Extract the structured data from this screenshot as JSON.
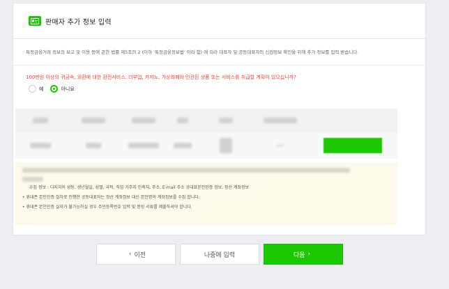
{
  "header": {
    "title": "판매자 추가 정보 입력"
  },
  "notice": {
    "text": "· 특정금융거래 정보의 보고 및 이용 등에 관한 법률 제5조의 2 (이하 '특정금융정보법' 이라 함) 에 따라 대표자 및 공동대표자의 신원정보 확인을 위해 추가 정보를 입력 받습니다."
  },
  "question": {
    "text": "100만원 이상의 귀금속, 외환에 대한 환전서비스, 더부업, 카지노, 가상화폐와 인관된 상품 또는 서비스를 취급할 계획이 있으십니까?",
    "options": [
      {
        "label": "예",
        "selected": false
      },
      {
        "label": "아니요",
        "selected": true
      }
    ]
  },
  "info": {
    "line_collect": "수집 정보 : 디지치의 성동, 생년월일, 성별, 국적, 직업 가주지 인축처, 주소, E-mail 주소 공대표본인인증 정보, 정산 계좌정보",
    "line_note1": "• 휴대폰 본인인증 절차로 진행한 공동대표자는 정산 계좌정보 대신 본인명의 계좌정보를 수집 합니다.",
    "line_note2": "• 휴대폰 본인인증 실자가 불가능하실 경우 주민등록번호 입력 및 증빙 서류를 제출하셔야 합니다."
  },
  "buttons": {
    "prev": "이전",
    "later": "나중에 입력",
    "next": "다음"
  },
  "colors": {
    "accent": "#1ec800",
    "warning": "#e8433d",
    "info_bg": "#fdfaec"
  }
}
